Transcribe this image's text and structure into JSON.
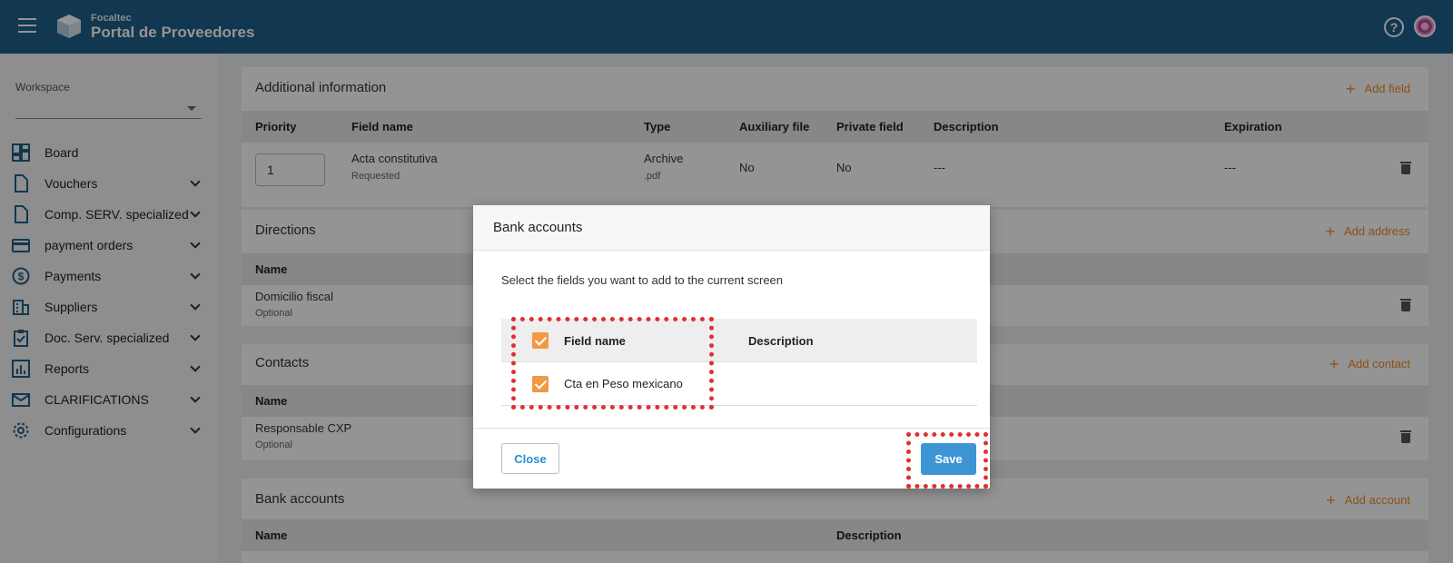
{
  "header": {
    "brand_small": "Focaltec",
    "brand_name": "Portal de Proveedores",
    "help_symbol": "?"
  },
  "sidebar": {
    "workspace_label": "Workspace",
    "workspace_value": "",
    "items": [
      {
        "label": "Board",
        "icon": "dashboard-icon"
      },
      {
        "label": "Vouchers",
        "icon": "document-icon"
      },
      {
        "label": "Comp. SERV. specialized",
        "icon": "document-icon"
      },
      {
        "label": "payment orders",
        "icon": "credit-card-icon"
      },
      {
        "label": "Payments",
        "icon": "dollar-icon"
      },
      {
        "label": "Suppliers",
        "icon": "building-icon"
      },
      {
        "label": "Doc. Serv. specialized",
        "icon": "clipboard-check-icon"
      },
      {
        "label": "Reports",
        "icon": "chart-icon"
      },
      {
        "label": "CLARIFICATIONS",
        "icon": "mail-icon"
      },
      {
        "label": "Configurations",
        "icon": "gear-icon"
      }
    ]
  },
  "main": {
    "additional": {
      "title": "Additional information",
      "action": "Add field",
      "columns": [
        "Priority",
        "Field name",
        "Type",
        "Auxiliary file",
        "Private field",
        "Description",
        "Expiration"
      ],
      "row": {
        "priority": "1",
        "field_name": "Acta constitutiva",
        "field_status": "Requested",
        "type": "Archive",
        "type_ext": ".pdf",
        "auxiliary": "No",
        "private": "No",
        "description": "---",
        "expiration": "---"
      }
    },
    "directions": {
      "title": "Directions",
      "action": "Add address",
      "column": "Name",
      "row_name": "Domicilio fiscal",
      "row_status": "Optional"
    },
    "contacts": {
      "title": "Contacts",
      "action": "Add contact",
      "column": "Name",
      "row_name": "Responsable CXP",
      "row_status": "Optional"
    },
    "bank_accounts": {
      "title": "Bank accounts",
      "action": "Add account",
      "col_name": "Name",
      "col_description": "Description"
    }
  },
  "modal": {
    "title": "Bank accounts",
    "description": "Select the fields you want to add to the current screen",
    "col_field_name": "Field name",
    "col_description": "Description",
    "row_field_name": "Cta en Peso mexicano",
    "row_description": "",
    "header_checked": true,
    "row_checked": true,
    "close_label": "Close",
    "save_label": "Save"
  },
  "colors": {
    "topbar": "#1f5f8b",
    "accent_orange": "#f39845",
    "primary_blue": "#3d95d6",
    "highlight_red": "#e03131"
  }
}
